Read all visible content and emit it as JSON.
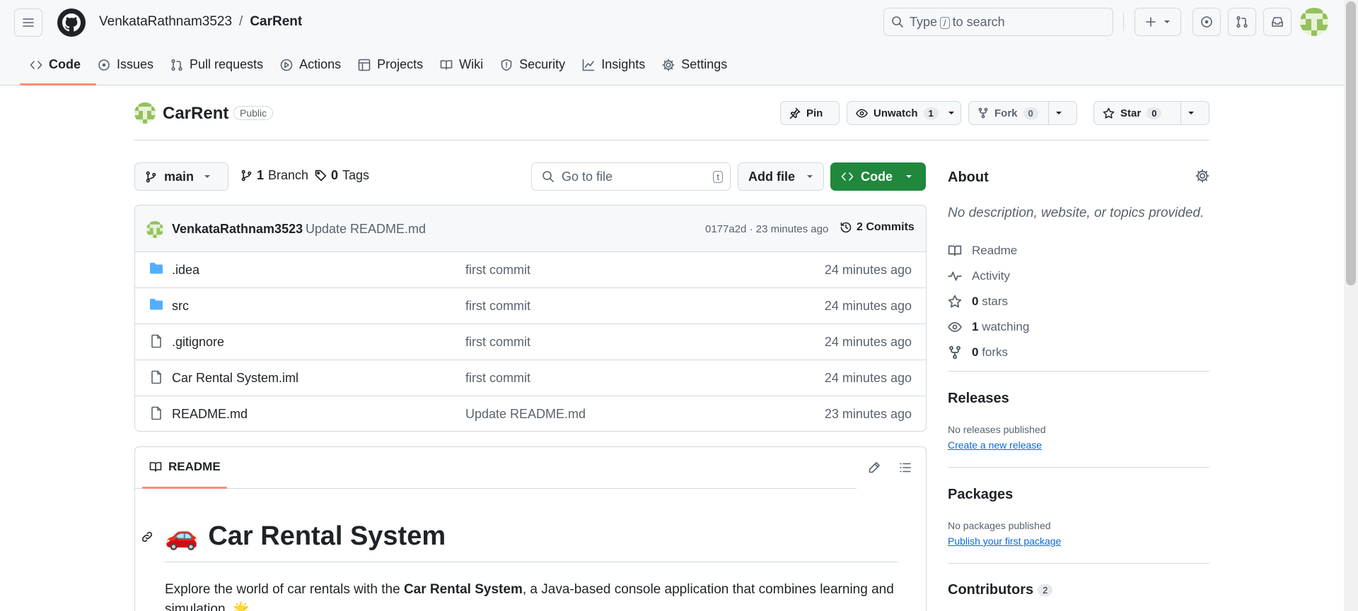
{
  "header": {
    "owner": "VenkataRathnam3523",
    "separator": "/",
    "repo": "CarRent",
    "search_prefix": "Type",
    "search_key": "/",
    "search_suffix": "to search"
  },
  "tabs": [
    {
      "label": "Code",
      "icon": "code-icon"
    },
    {
      "label": "Issues",
      "icon": "issue-icon"
    },
    {
      "label": "Pull requests",
      "icon": "pull-request-icon"
    },
    {
      "label": "Actions",
      "icon": "play-icon"
    },
    {
      "label": "Projects",
      "icon": "table-icon"
    },
    {
      "label": "Wiki",
      "icon": "book-icon"
    },
    {
      "label": "Security",
      "icon": "shield-icon"
    },
    {
      "label": "Insights",
      "icon": "graph-icon"
    },
    {
      "label": "Settings",
      "icon": "gear-icon"
    }
  ],
  "repo_head": {
    "name": "CarRent",
    "visibility": "Public",
    "pin_label": "Pin",
    "unwatch_label": "Unwatch",
    "watch_count": "1",
    "fork_label": "Fork",
    "fork_count": "0",
    "star_label": "Star",
    "star_count": "0"
  },
  "file_nav": {
    "branch": "main",
    "branches_count": "1",
    "branches_label": "Branch",
    "tags_count": "0",
    "tags_label": "Tags",
    "goto_placeholder": "Go to file",
    "goto_key": "t",
    "add_file_label": "Add file",
    "code_label": "Code"
  },
  "commit": {
    "author": "VenkataRathnam3523",
    "message": "Update README.md",
    "meta": "0177a2d · 23 minutes ago",
    "commits_label": "2 Commits"
  },
  "files": [
    {
      "name": ".idea",
      "type": "folder",
      "message": "first commit",
      "age": "24 minutes ago"
    },
    {
      "name": "src",
      "type": "folder",
      "message": "first commit",
      "age": "24 minutes ago"
    },
    {
      "name": ".gitignore",
      "type": "file",
      "message": "first commit",
      "age": "24 minutes ago"
    },
    {
      "name": "Car Rental System.iml",
      "type": "file",
      "message": "first commit",
      "age": "24 minutes ago"
    },
    {
      "name": "README.md",
      "type": "file",
      "message": "Update README.md",
      "age": "23 minutes ago"
    }
  ],
  "readme": {
    "tab_label": "README",
    "title_emoji": "🚗",
    "title": "Car Rental System",
    "para_before": "Explore the world of car rentals with the ",
    "para_bold": "Car Rental System",
    "para_after": ", a Java-based console application that combines learning and simulation.",
    "para_emoji": "🌟"
  },
  "sidebar": {
    "about_title": "About",
    "about_desc": "No description, website, or topics provided.",
    "items": [
      {
        "icon": "book-icon",
        "count": "",
        "label": "Readme"
      },
      {
        "icon": "pulse-icon",
        "count": "",
        "label": "Activity"
      },
      {
        "icon": "star-icon",
        "count": "0",
        "label": "stars"
      },
      {
        "icon": "eye-icon",
        "count": "1",
        "label": "watching"
      },
      {
        "icon": "fork-icon",
        "count": "0",
        "label": "forks"
      }
    ],
    "releases_title": "Releases",
    "releases_text": "No releases published",
    "releases_link": "Create a new release",
    "packages_title": "Packages",
    "packages_text": "No packages published",
    "packages_link": "Publish your first package",
    "contributors_title": "Contributors",
    "contributors_count": "2"
  },
  "colors": {
    "accent_green": "#1f883d",
    "tab_underline": "#fd8c73",
    "link": "#0969da",
    "folder": "#54aeff"
  }
}
